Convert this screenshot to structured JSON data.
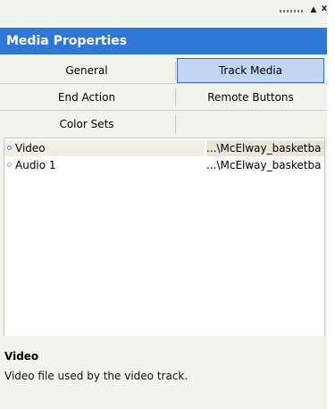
{
  "window": {
    "collapse_icon": "▲",
    "close_icon": "x"
  },
  "header": {
    "title": "Media Properties"
  },
  "tabs": [
    {
      "label": "General",
      "active": false
    },
    {
      "label": "Track Media",
      "active": true
    },
    {
      "label": "End Action",
      "active": false
    },
    {
      "label": "Remote Buttons",
      "active": false
    },
    {
      "label": "Color Sets",
      "active": false
    }
  ],
  "tracks": [
    {
      "name": "Video",
      "path": "...\\McElway_basketba",
      "selected": true
    },
    {
      "name": "Audio 1",
      "path": "...\\McElway_basketba",
      "selected": false
    }
  ],
  "description": {
    "title": "Video",
    "text": "Video file used by the video track."
  },
  "colors": {
    "header_bg": "#2d77d6",
    "active_tab_bg": "#c1d6f4",
    "active_tab_border": "#3f6db8",
    "panel_bg": "#f3f3ee"
  }
}
